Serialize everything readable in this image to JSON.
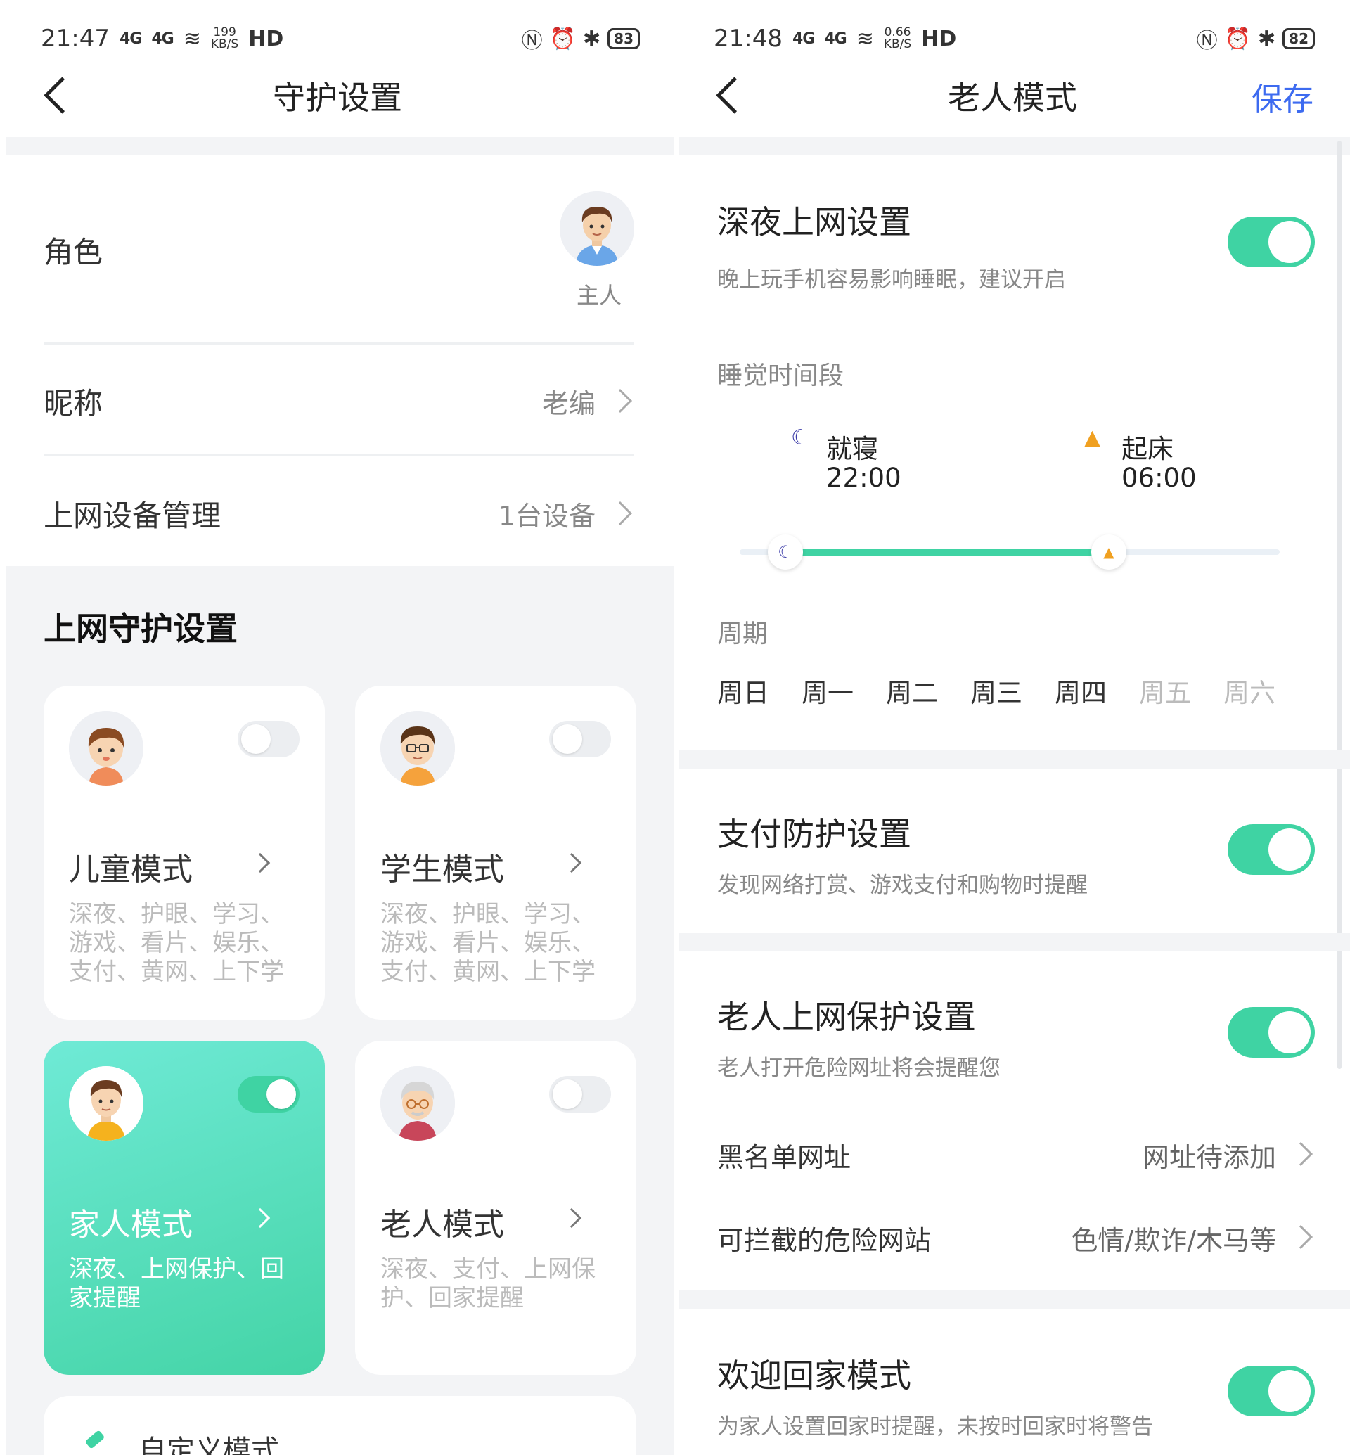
{
  "left": {
    "status": {
      "time": "21:47",
      "signal1": "4G",
      "signal2": "4G",
      "net_speed": "199",
      "net_unit": "KB/S",
      "hd": "HD",
      "battery": "83"
    },
    "header": {
      "title": "守护设置"
    },
    "role": {
      "label": "角色",
      "avatar_name": "主人"
    },
    "nickname": {
      "label": "昵称",
      "value": "老编"
    },
    "devices": {
      "label": "上网设备管理",
      "value": "1台设备"
    },
    "section_title": "上网守护设置",
    "cards": [
      {
        "title": "儿童模式",
        "desc": "深夜、护眼、学习、游戏、看片、娱乐、支付、黄网、上下学",
        "enabled": false
      },
      {
        "title": "学生模式",
        "desc": "深夜、护眼、学习、游戏、看片、娱乐、支付、黄网、上下学",
        "enabled": false
      },
      {
        "title": "家人模式",
        "desc": "深夜、上网保护、回家提醒",
        "enabled": true
      },
      {
        "title": "老人模式",
        "desc": "深夜、支付、上网保护、回家提醒",
        "enabled": false
      }
    ],
    "custom_mode": "自定义模式"
  },
  "right": {
    "status": {
      "time": "21:48",
      "signal1": "4G",
      "signal2": "4G",
      "net_speed": "0.66",
      "net_unit": "KB/S",
      "hd": "HD",
      "battery": "82"
    },
    "header": {
      "title": "老人模式",
      "save": "保存"
    },
    "night": {
      "title": "深夜上网设置",
      "sub": "晚上玩手机容易影响睡眠，建议开启",
      "enabled": true,
      "sleep_period_label": "睡觉时间段",
      "bed_label": "就寝",
      "bed_time": "22:00",
      "wake_label": "起床",
      "wake_time": "06:00",
      "cycle_label": "周期",
      "days": [
        "周日",
        "周一",
        "周二",
        "周三",
        "周四",
        "周五",
        "周六"
      ],
      "days_active": [
        true,
        true,
        true,
        true,
        true,
        false,
        false
      ]
    },
    "payment": {
      "title": "支付防护设置",
      "sub": "发现网络打赏、游戏支付和购物时提醒",
      "enabled": true
    },
    "elder": {
      "title": "老人上网保护设置",
      "sub": "老人打开危险网址将会提醒您",
      "enabled": true,
      "blacklist_label": "黑名单网址",
      "blacklist_value": "网址待添加",
      "danger_label": "可拦截的危险网站",
      "danger_value": "色情/欺诈/木马等"
    },
    "welcome": {
      "title": "欢迎回家模式",
      "sub": "为家人设置回家时提醒，未按时回家时将警告",
      "enabled": true
    }
  },
  "colors": {
    "accent_green": "#3fd3a3",
    "save_blue": "#3d6bf0",
    "bg_gray": "#f3f4f6"
  }
}
